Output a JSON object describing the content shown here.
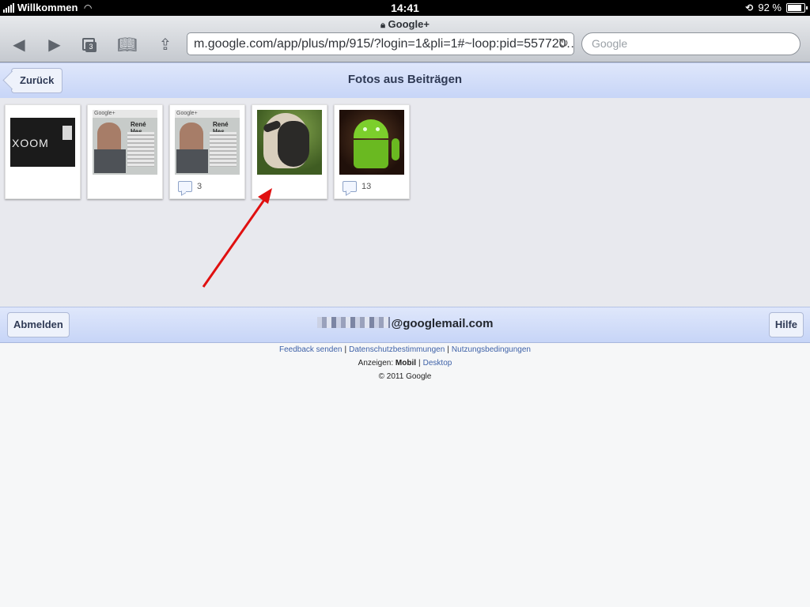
{
  "status_bar": {
    "carrier": "Willkommen",
    "time": "14:41",
    "battery": "92 %",
    "battery_level": 0.92
  },
  "browser": {
    "page_title": "Google+",
    "url": "m.google.com/app/plus/mp/915/?login=1&pli=1#~loop:pid=557720…",
    "search_placeholder": "Google",
    "tab_count": "3"
  },
  "header": {
    "back_label": "Zurück",
    "title": "Fotos aus Beiträgen"
  },
  "photos": [
    {
      "name": "xoom",
      "comment_count": ""
    },
    {
      "name": "screenshot",
      "comment_count": ""
    },
    {
      "name": "screenshot",
      "comment_count": "3"
    },
    {
      "name": "sheep",
      "comment_count": ""
    },
    {
      "name": "android",
      "comment_count": "13"
    }
  ],
  "thumb_text": {
    "xoom": "XOOM",
    "screen_name": "René Hes",
    "screen_logo": "Google+"
  },
  "account_bar": {
    "logout_label": "Abmelden",
    "email_suffix": "@googlemail.com",
    "help_label": "Hilfe"
  },
  "footer": {
    "feedback": "Feedback senden",
    "privacy": "Datenschutzbestimmungen",
    "terms": "Nutzungsbedingungen",
    "view_label": "Anzeigen:",
    "mobile": "Mobil",
    "desktop": "Desktop",
    "copyright": "© 2011 Google"
  },
  "colors": {
    "header_bar": "#c7d5f7",
    "link": "#3f62a8",
    "annotation_arrow": "#e01010"
  }
}
